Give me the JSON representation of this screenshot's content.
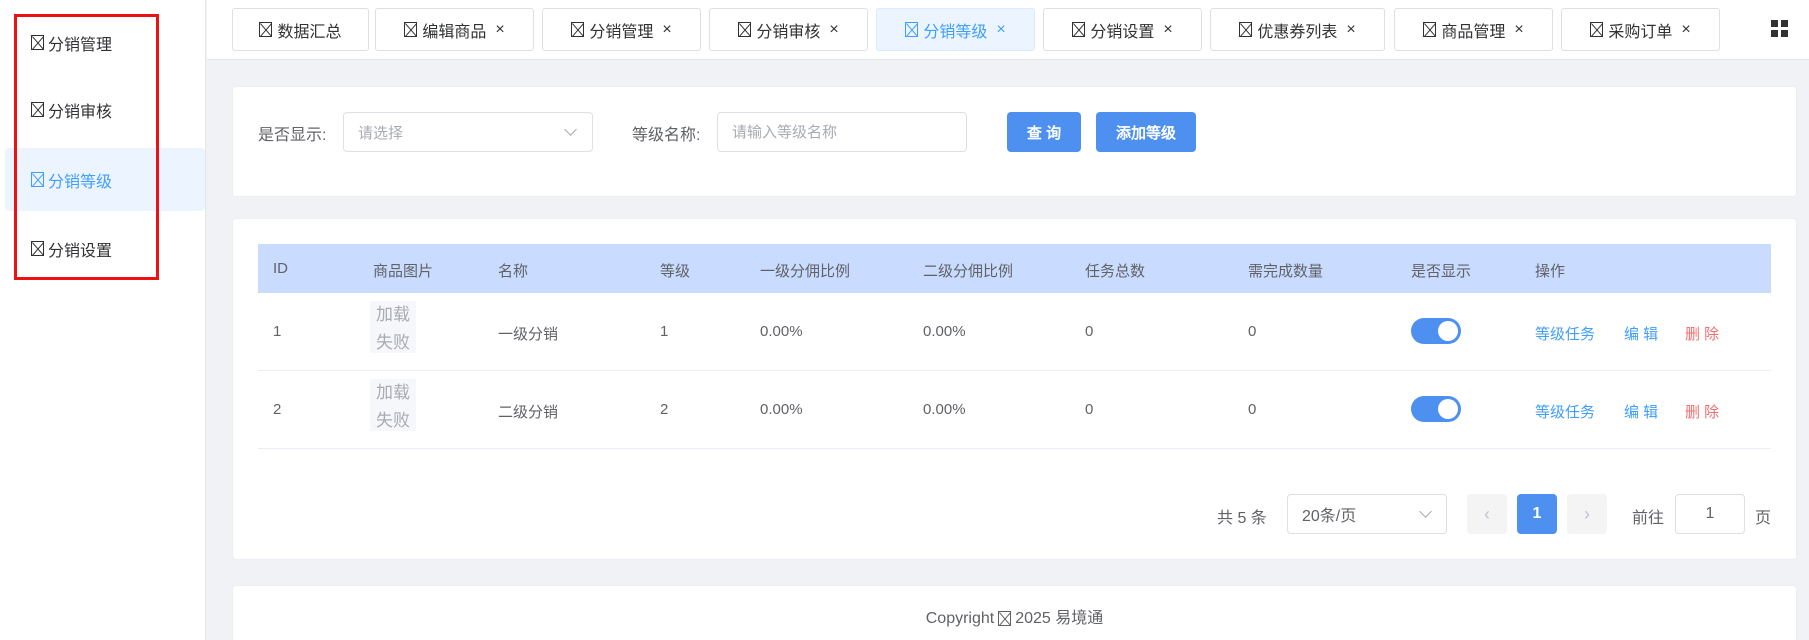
{
  "sidebar": {
    "items": [
      {
        "label": "分销管理",
        "icon": "broken-icon",
        "active": false
      },
      {
        "label": "分销审核",
        "icon": "broken-icon",
        "active": false
      },
      {
        "label": "分销等级",
        "icon": "broken-icon",
        "active": true
      },
      {
        "label": "分销设置",
        "icon": "broken-icon",
        "active": false
      }
    ],
    "highlight_color": "#ee1111"
  },
  "tabs": [
    {
      "label": "数据汇总",
      "closable": false,
      "active": false
    },
    {
      "label": "编辑商品",
      "closable": true,
      "active": false
    },
    {
      "label": "分销管理",
      "closable": true,
      "active": false
    },
    {
      "label": "分销审核",
      "closable": true,
      "active": false
    },
    {
      "label": "分销等级",
      "closable": true,
      "active": true
    },
    {
      "label": "分销设置",
      "closable": true,
      "active": false
    },
    {
      "label": "优惠券列表",
      "closable": true,
      "active": false
    },
    {
      "label": "商品管理",
      "closable": true,
      "active": false
    },
    {
      "label": "采购订单",
      "closable": true,
      "active": false
    }
  ],
  "tab_close_glyph": "×",
  "filter": {
    "show_label": "是否显示:",
    "show_placeholder": "请选择",
    "name_label": "等级名称:",
    "name_placeholder": "请输入等级名称",
    "query_button": "查 询",
    "add_button": "添加等级"
  },
  "table": {
    "headers": [
      "ID",
      "商品图片",
      "名称",
      "等级",
      "一级分佣比例",
      "二级分佣比例",
      "任务总数",
      "需完成数量",
      "是否显示",
      "操作"
    ],
    "rows": [
      {
        "id": "1",
        "image_text_1": "加载",
        "image_text_2": "失败",
        "name": "一级分销",
        "level": "1",
        "rate1": "0.00%",
        "rate2": "0.00%",
        "task_total": "0",
        "required": "0",
        "show": true
      },
      {
        "id": "2",
        "image_text_1": "加载",
        "image_text_2": "失败",
        "name": "二级分销",
        "level": "2",
        "rate1": "0.00%",
        "rate2": "0.00%",
        "task_total": "0",
        "required": "0",
        "show": true
      }
    ],
    "actions": {
      "task": "等级任务",
      "edit": "编 辑",
      "delete": "删 除"
    }
  },
  "pagination": {
    "total_text": "共 5 条",
    "page_size": "20条/页",
    "current_page": "1",
    "prev_glyph": "‹",
    "next_glyph": "›",
    "goto_label": "前往",
    "goto_value": "1",
    "page_suffix": "页"
  },
  "footer": {
    "copyright_prefix": "Copyright",
    "copyright_suffix": "2025 易境通"
  },
  "colors": {
    "primary": "#4d90f0",
    "table_header": "#c9dcff",
    "danger": "#f56c6c",
    "active_bg": "#ecf5ff"
  }
}
